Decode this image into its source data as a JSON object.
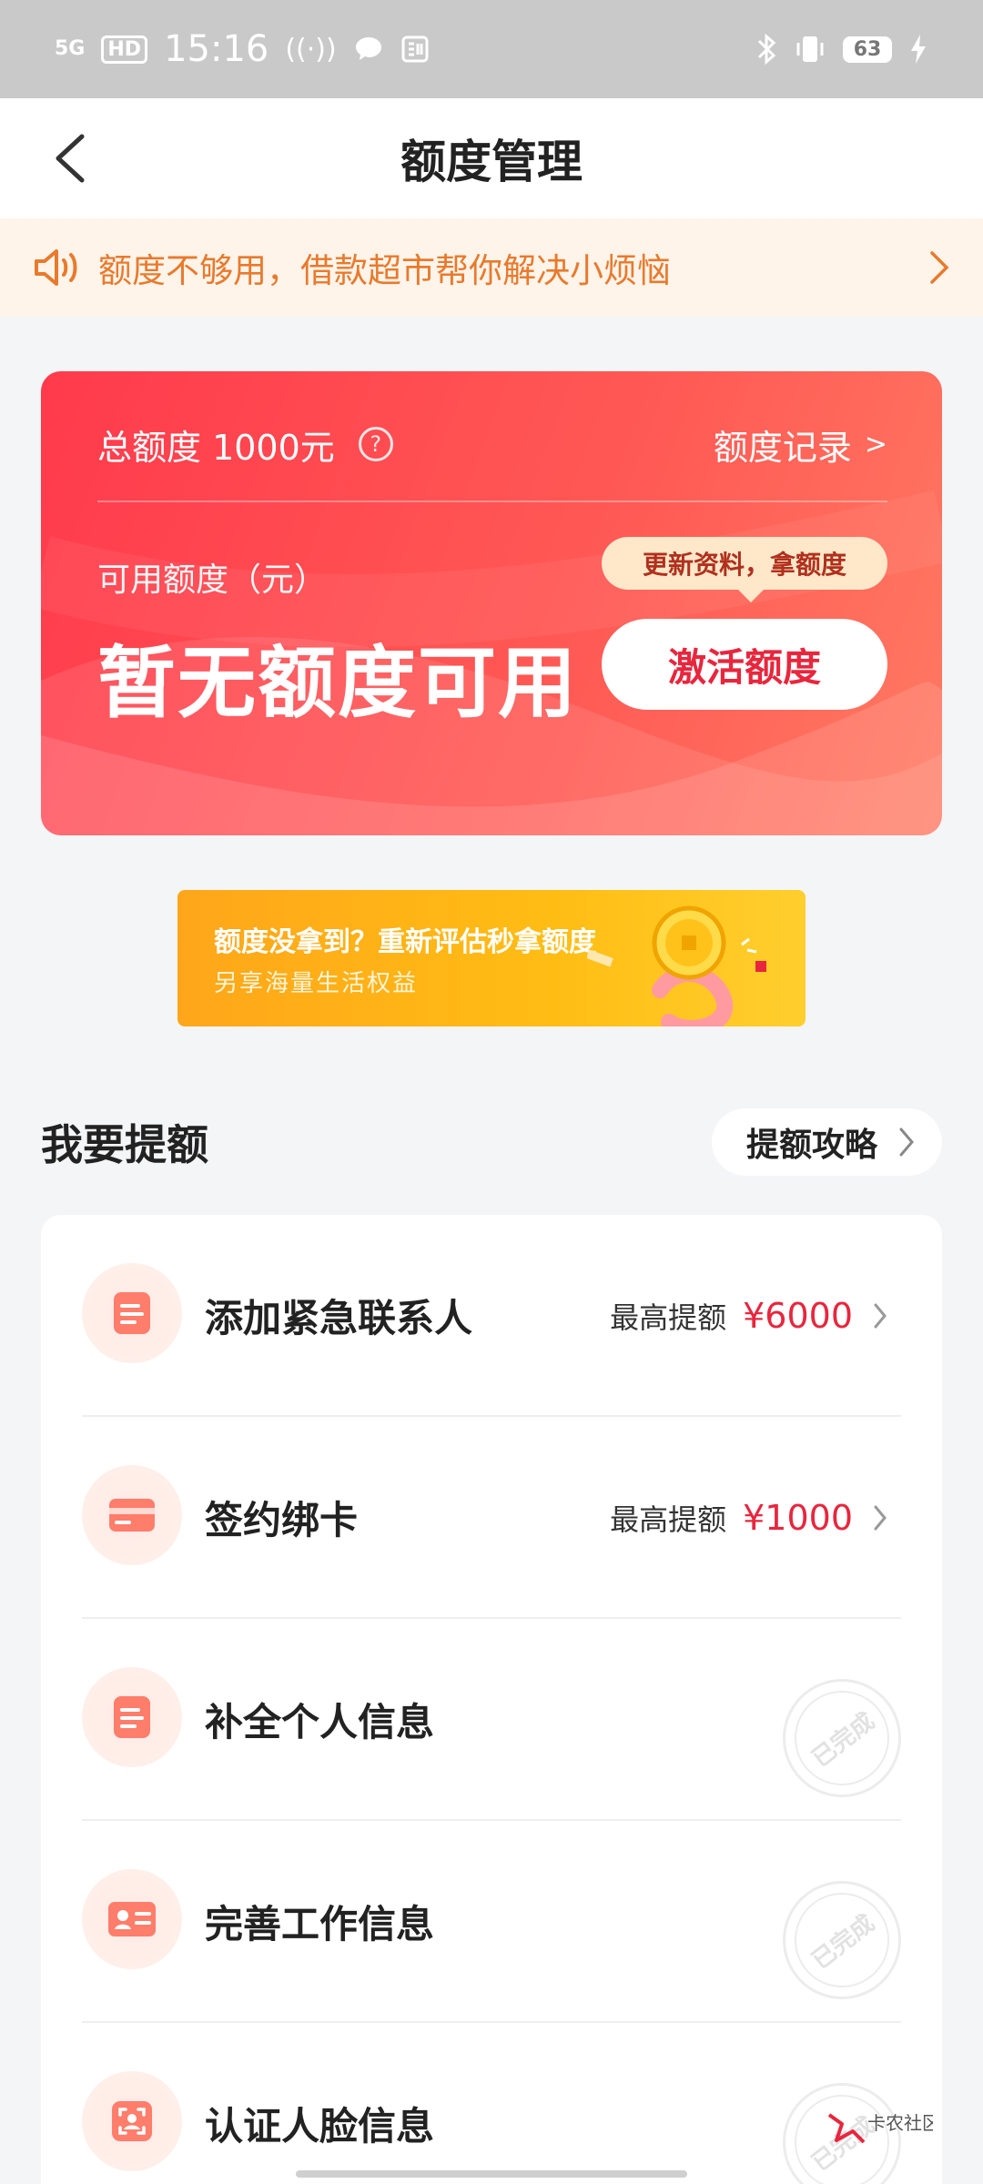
{
  "status_bar": {
    "network": "5G",
    "hd": "HD",
    "time": "15:16",
    "battery": "63"
  },
  "header": {
    "title": "额度管理"
  },
  "notice": {
    "text": "额度不够用，借款超市帮你解决小烦恼"
  },
  "credit_card": {
    "total_label": "总额度 1000元",
    "help_glyph": "?",
    "record_label": "额度记录",
    "record_arrow": ">",
    "available_label": "可用额度（元）",
    "available_value": "暂无额度可用",
    "tip": "更新资料，拿额度",
    "activate_label": "激活额度"
  },
  "promo": {
    "title": "额度没拿到？重新评估秒拿额度",
    "subtitle": "另享海量生活权益"
  },
  "section": {
    "title": "我要提额",
    "strategy_label": "提额攻略"
  },
  "tasks": [
    {
      "title": "添加紧急联系人",
      "max_label": "最高提额",
      "max_amount": "¥6000",
      "icon": "document-icon"
    },
    {
      "title": "签约绑卡",
      "max_label": "最高提额",
      "max_amount": "¥1000",
      "icon": "bank-card-icon"
    },
    {
      "title": "补全个人信息",
      "status": "已完成",
      "icon": "document-icon"
    },
    {
      "title": "完善工作信息",
      "status": "已完成",
      "icon": "id-card-icon"
    },
    {
      "title": "认证人脸信息",
      "status": "已完成",
      "icon": "face-scan-icon"
    }
  ],
  "watermark": {
    "text": "卡农社区"
  },
  "colors": {
    "accent": "#e8263d",
    "notice_text": "#e87a2d",
    "card_start": "#ff3a4c",
    "card_end": "#ff7a62",
    "promo": "#ffb318"
  }
}
